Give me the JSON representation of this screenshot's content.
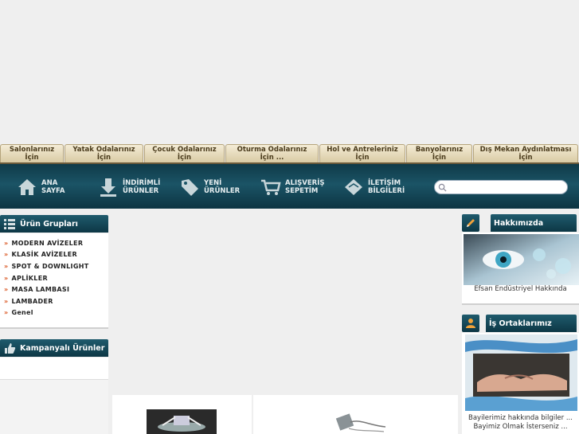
{
  "category_tabs": [
    {
      "label": "Salonlarınız\nİçin",
      "w": 80
    },
    {
      "label": "Yatak Odalarınız\nİçin",
      "w": 99
    },
    {
      "label": "Çocuk Odalarınız\nİçin",
      "w": 101
    },
    {
      "label": "Oturma Odalarınız\nİçin ...",
      "w": 117
    },
    {
      "label": "Hol ve Antreleriniz\nİçin",
      "w": 108
    },
    {
      "label": "Banyolarınız\nİçin",
      "w": 83
    },
    {
      "label": "Dış Mekan Aydınlatması\nİçin",
      "w": 132
    }
  ],
  "nav": {
    "home": "ANA\nSAYFA",
    "discount": "İNDİRİMLİ\nÜRÜNLER",
    "new": "YENİ\nÜRÜNLER",
    "cart": "ALIŞVERİŞ\nSEPETİM",
    "contact": "İLETİŞİM\nBİLGİLERİ",
    "search_placeholder": ""
  },
  "product_groups": {
    "title": "Ürün Grupları",
    "items": [
      "MODERN AVİZELER",
      "KLASİK AVİZELER",
      "SPOT & DOWNLIGHT",
      "APLİKLER",
      "MASA LAMBASI",
      "LAMBADER",
      "Genel"
    ]
  },
  "campaign": {
    "title": "Kampanyalı Ürünler"
  },
  "about": {
    "title": "Hakkımızda",
    "caption": "Efsan  Endüstriyel Hakkında"
  },
  "partners": {
    "title": "İş Ortaklarımız",
    "caption_line1": "Bayilerimiz hakkında bilgiler ...",
    "caption_line2": "Bayimiz Olmak İsterseniz ..."
  },
  "colors": {
    "nav_dark": "#0d3745",
    "accent_arrow": "#d9531e",
    "tab_bg": "#e6dbbc"
  }
}
